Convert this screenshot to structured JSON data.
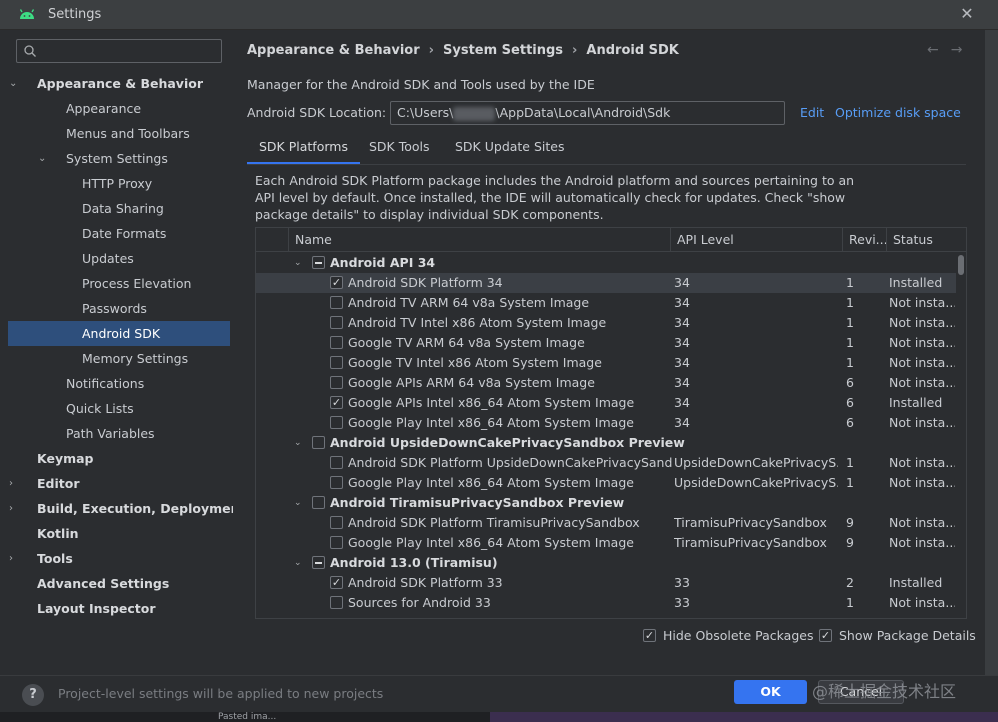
{
  "window": {
    "title": "Settings",
    "close_glyph": "✕",
    "app_icon": "android-icon"
  },
  "search": {
    "value": "",
    "placeholder": "",
    "icon": "search-icon"
  },
  "sidebar": {
    "items": [
      {
        "label": "Appearance & Behavior",
        "level": 0,
        "bold": true,
        "expanded": true
      },
      {
        "label": "Appearance",
        "level": 1
      },
      {
        "label": "Menus and Toolbars",
        "level": 1
      },
      {
        "label": "System Settings",
        "level": 1,
        "expanded": true
      },
      {
        "label": "HTTP Proxy",
        "level": 2
      },
      {
        "label": "Data Sharing",
        "level": 2
      },
      {
        "label": "Date Formats",
        "level": 2
      },
      {
        "label": "Updates",
        "level": 2
      },
      {
        "label": "Process Elevation",
        "level": 2
      },
      {
        "label": "Passwords",
        "level": 2
      },
      {
        "label": "Android SDK",
        "level": 2,
        "selected": true
      },
      {
        "label": "Memory Settings",
        "level": 2
      },
      {
        "label": "Notifications",
        "level": 1
      },
      {
        "label": "Quick Lists",
        "level": 1
      },
      {
        "label": "Path Variables",
        "level": 1
      },
      {
        "label": "Keymap",
        "level": 0,
        "bold": true
      },
      {
        "label": "Editor",
        "level": 0,
        "bold": true,
        "collapsed": true
      },
      {
        "label": "Build, Execution, Deployment",
        "level": 0,
        "bold": true,
        "collapsed": true
      },
      {
        "label": "Kotlin",
        "level": 0,
        "bold": true
      },
      {
        "label": "Tools",
        "level": 0,
        "bold": true,
        "collapsed": true
      },
      {
        "label": "Advanced Settings",
        "level": 0,
        "bold": true
      },
      {
        "label": "Layout Inspector",
        "level": 0,
        "bold": true
      }
    ]
  },
  "breadcrumb": {
    "items": [
      "Appearance & Behavior",
      "System Settings",
      "Android SDK"
    ],
    "separator": "›",
    "back": "←",
    "forward": "→"
  },
  "main": {
    "description": "Manager for the Android SDK and Tools used by the IDE",
    "sdk_location_label": "Android SDK Location:",
    "sdk_location_prefix": "C:\\Users\\",
    "sdk_location_suffix": "\\AppData\\Local\\Android\\Sdk",
    "edit_link": "Edit",
    "optimize_link": "Optimize disk space"
  },
  "tabs": [
    {
      "label": "SDK Platforms",
      "active": true
    },
    {
      "label": "SDK Tools"
    },
    {
      "label": "SDK Update Sites"
    }
  ],
  "tab_description": "Each Android SDK Platform package includes the Android platform and sources pertaining to an API level by default. Once installed, the IDE will automatically check for updates. Check \"show package details\" to display individual SDK components.",
  "table": {
    "columns": [
      "Name",
      "API Level",
      "Revi...",
      "Status"
    ],
    "rows": [
      {
        "group": true,
        "check": "partial",
        "name": "Android API 34",
        "api": "",
        "rev": "",
        "status": ""
      },
      {
        "check": "checked",
        "name": "Android SDK Platform 34",
        "api": "34",
        "rev": "1",
        "status": "Installed",
        "highlight": true
      },
      {
        "check": "unchecked",
        "name": "Android TV ARM 64 v8a System Image",
        "api": "34",
        "rev": "1",
        "status": "Not insta..."
      },
      {
        "check": "unchecked",
        "name": "Android TV Intel x86 Atom System Image",
        "api": "34",
        "rev": "1",
        "status": "Not insta..."
      },
      {
        "check": "unchecked",
        "name": "Google TV ARM 64 v8a System Image",
        "api": "34",
        "rev": "1",
        "status": "Not insta..."
      },
      {
        "check": "unchecked",
        "name": "Google TV Intel x86 Atom System Image",
        "api": "34",
        "rev": "1",
        "status": "Not insta..."
      },
      {
        "check": "unchecked",
        "name": "Google APIs ARM 64 v8a System Image",
        "api": "34",
        "rev": "6",
        "status": "Not insta..."
      },
      {
        "check": "checked",
        "name": "Google APIs Intel x86_64 Atom System Image",
        "api": "34",
        "rev": "6",
        "status": "Installed"
      },
      {
        "check": "unchecked",
        "name": "Google Play Intel x86_64 Atom System Image",
        "api": "34",
        "rev": "6",
        "status": "Not insta..."
      },
      {
        "group": true,
        "check": "unchecked",
        "name": "Android UpsideDownCakePrivacySandbox Preview",
        "api": "",
        "rev": "",
        "status": ""
      },
      {
        "check": "unchecked",
        "name": "Android SDK Platform UpsideDownCakePrivacySandbox",
        "api": "UpsideDownCakePrivacyS...",
        "rev": "1",
        "status": "Not insta..."
      },
      {
        "check": "unchecked",
        "name": "Google Play Intel x86_64 Atom System Image",
        "api": "UpsideDownCakePrivacyS...",
        "rev": "1",
        "status": "Not insta..."
      },
      {
        "group": true,
        "check": "unchecked",
        "name": "Android TiramisuPrivacySandbox Preview",
        "api": "",
        "rev": "",
        "status": ""
      },
      {
        "check": "unchecked",
        "name": "Android SDK Platform TiramisuPrivacySandbox",
        "api": "TiramisuPrivacySandbox",
        "rev": "9",
        "status": "Not insta..."
      },
      {
        "check": "unchecked",
        "name": "Google Play Intel x86_64 Atom System Image",
        "api": "TiramisuPrivacySandbox",
        "rev": "9",
        "status": "Not insta..."
      },
      {
        "group": true,
        "check": "partial",
        "name": "Android 13.0 (Tiramisu)",
        "api": "",
        "rev": "",
        "status": ""
      },
      {
        "check": "checked",
        "name": "Android SDK Platform 33",
        "api": "33",
        "rev": "2",
        "status": "Installed"
      },
      {
        "check": "unchecked",
        "name": "Sources for Android 33",
        "api": "33",
        "rev": "1",
        "status": "Not insta..."
      }
    ]
  },
  "options": {
    "hide_obsolete": {
      "label": "Hide Obsolete Packages",
      "checked": true
    },
    "show_details": {
      "label": "Show Package Details",
      "checked": true
    }
  },
  "footer": {
    "help": "?",
    "note": "Project-level settings will be applied to new projects",
    "ok": "OK",
    "cancel": "Cancel",
    "watermark": "@稀土掘金技术社区"
  },
  "taskbar": {
    "fragment": "Pasted ima..."
  },
  "colors": {
    "accent": "#3574f0",
    "link": "#589df6",
    "selection": "#2e4f7c",
    "background": "#2b2d30"
  }
}
